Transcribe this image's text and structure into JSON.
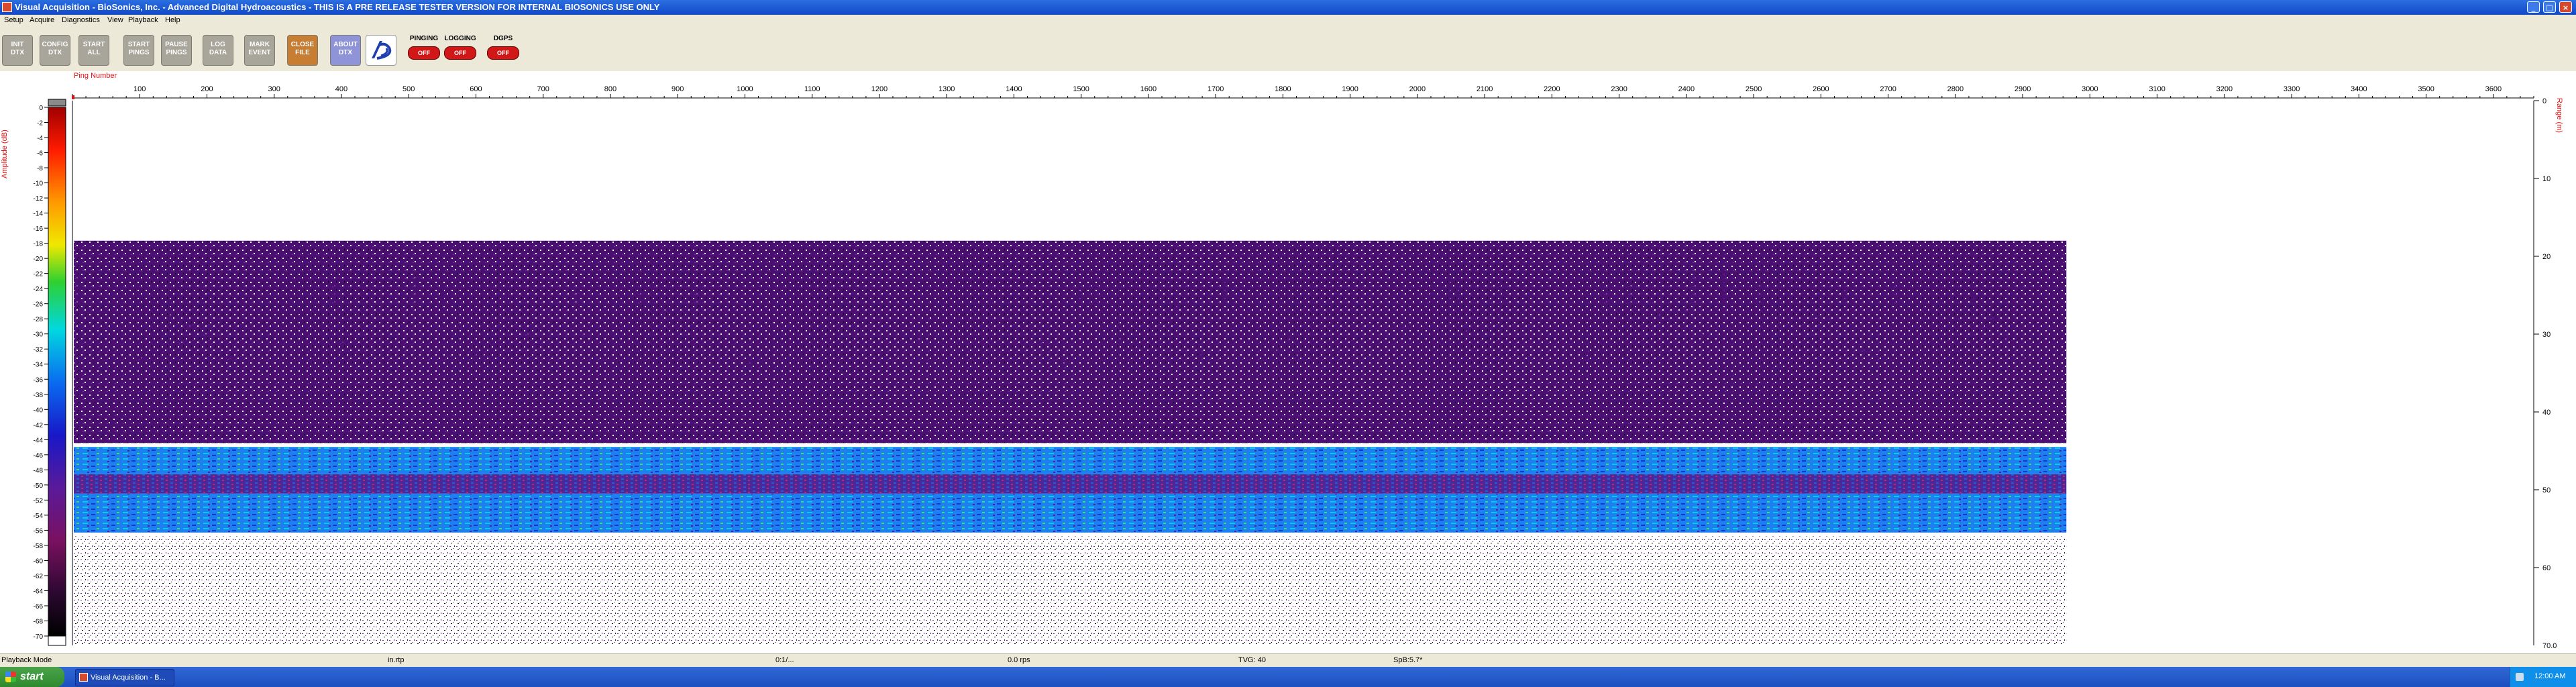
{
  "window": {
    "title": "Visual Acquisition  -  BioSonics, Inc.  -  Advanced Digital Hydroacoustics  -  THIS IS A PRE RELEASE TESTER VERSION FOR INTERNAL BIOSONICS USE ONLY",
    "minimize": "_",
    "maximize": "□",
    "close": "×"
  },
  "menu": [
    "Setup",
    "Acquire",
    "Diagnostics",
    "View",
    "Playback",
    "Help"
  ],
  "toolbar": {
    "buttons": [
      {
        "l1": "INIT",
        "l2": "DTX"
      },
      {
        "l1": "CONFIG",
        "l2": "DTX"
      },
      {
        "l1": "START",
        "l2": "ALL"
      },
      {
        "l1": "START",
        "l2": "PINGS"
      },
      {
        "l1": "PAUSE",
        "l2": "PINGS"
      },
      {
        "l1": "LOG",
        "l2": "DATA"
      },
      {
        "l1": "MARK",
        "l2": "EVENT"
      },
      {
        "l1": "CLOSE",
        "l2": "FILE"
      },
      {
        "l1": "ABOUT",
        "l2": "DTX"
      }
    ],
    "logo_icon": "biosonics-logo-icon",
    "indicators": [
      {
        "label": "PINGING",
        "state": "OFF"
      },
      {
        "label": "LOGGING",
        "state": "OFF"
      },
      {
        "label": "DGPS",
        "state": "OFF"
      }
    ]
  },
  "colors": {
    "titlebar": "#1048c8",
    "echogram_purple": "#4b0f73",
    "echogram_band": "#1e7ff0",
    "axis_label": "#e01010"
  },
  "chart_data": {
    "type": "heatmap",
    "xlabel": "Ping Number",
    "x_ticks": [
      100,
      200,
      300,
      400,
      500,
      600,
      700,
      800,
      900,
      1000,
      1100,
      1200,
      1300,
      1400,
      1500,
      1600,
      1700,
      1800,
      1900,
      2000,
      2100,
      2200,
      2300,
      2400,
      2500,
      2600,
      2700,
      2800,
      2900,
      3000,
      3100,
      3200,
      3300,
      3400,
      3500,
      3600
    ],
    "xlim": [
      0,
      3660
    ],
    "ylabel": "Range (m)",
    "y_ticks": [
      0,
      10,
      20,
      30,
      40,
      50,
      60
    ],
    "y_bottom_label": "70.0",
    "ylim": [
      0,
      70
    ],
    "colorbar_label": "Amplitude (dB)",
    "colorbar_ticks": [
      0,
      -2,
      -4,
      -6,
      -8,
      -10,
      -12,
      -14,
      -16,
      -18,
      -20,
      -22,
      -24,
      -26,
      -28,
      -30,
      -32,
      -34,
      -36,
      -38,
      -40,
      -42,
      -44,
      -46,
      -48,
      -50,
      -52,
      -54,
      -56,
      -58,
      -60,
      -62,
      -64,
      -66,
      -68,
      -70
    ],
    "data_extent_pings": 2965,
    "surface_noise_start_m": 18,
    "layers": [
      {
        "from_m": 18,
        "to_m": 44,
        "level": "sparse low-amplitude noise"
      },
      {
        "from_m": 44.5,
        "to_m": 48,
        "level": "strong scattering band"
      },
      {
        "from_m": 48,
        "to_m": 50.5,
        "level": "moderate"
      },
      {
        "from_m": 50.5,
        "to_m": 55.5,
        "level": "strong scattering band"
      },
      {
        "from_m": 56,
        "to_m": 70,
        "level": "sparse noise"
      }
    ]
  },
  "statusbar": {
    "mode": "Playback Mode",
    "file": "in.rtp",
    "time": "0:1/...",
    "rate": "0.0 rps",
    "tvg": "TVG: 40",
    "sp": "SpB:5.7*"
  },
  "taskbar": {
    "start": "start",
    "item": "Visual Acquisition - B...",
    "clock": "12:00 AM"
  }
}
